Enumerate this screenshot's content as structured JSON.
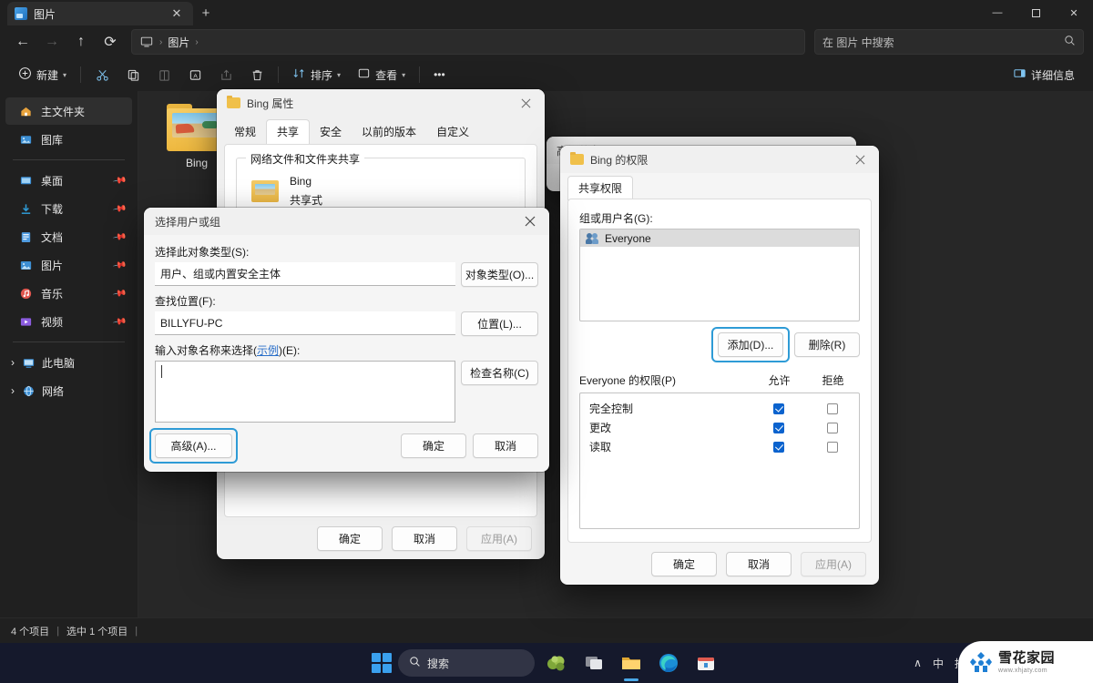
{
  "window": {
    "tab_title": "图片",
    "tab_close_glyph": "✕",
    "new_tab_glyph": "+",
    "minimize_glyph": "—",
    "maximize_glyph": "▢",
    "close_glyph": "✕"
  },
  "address": {
    "back_glyph": "←",
    "forward_glyph": "→",
    "up_glyph": "↑",
    "refresh_glyph": "⟳",
    "breadcrumb": [
      "图片"
    ],
    "separator": "›",
    "search_placeholder": "在 图片 中搜索",
    "search_icon": "⌕"
  },
  "toolbar": {
    "new_label": "新建",
    "cut_label": "剪切",
    "copy_label": "复制",
    "paste_label": "粘贴",
    "rename_label": "重命名",
    "share_label": "共享",
    "delete_label": "删除",
    "sort_label": "排序",
    "view_label": "查看",
    "more_label": "•••",
    "details_label": "详细信息"
  },
  "sidebar": {
    "items": [
      {
        "label": "主文件夹",
        "icon": "home-icon",
        "selected": true,
        "pinned": false
      },
      {
        "label": "图库",
        "icon": "gallery-icon",
        "selected": false,
        "pinned": false
      }
    ],
    "quick": [
      {
        "label": "桌面",
        "icon": "desktop-icon",
        "pinned": true
      },
      {
        "label": "下载",
        "icon": "downloads-icon",
        "pinned": true
      },
      {
        "label": "文档",
        "icon": "documents-icon",
        "pinned": true
      },
      {
        "label": "图片",
        "icon": "pictures-icon",
        "pinned": true
      },
      {
        "label": "音乐",
        "icon": "music-icon",
        "pinned": true
      },
      {
        "label": "视频",
        "icon": "videos-icon",
        "pinned": true
      }
    ],
    "groups": [
      {
        "label": "此电脑",
        "icon": "this-pc-icon"
      },
      {
        "label": "网络",
        "icon": "network-icon"
      }
    ]
  },
  "content": {
    "files": [
      {
        "name": "Bing",
        "type": "folder"
      }
    ]
  },
  "status": {
    "item_count": "4 个项目",
    "separator": "|",
    "selection": "选中 1 个项目"
  },
  "advanced_sharing_dialog": {
    "title": "高级共享"
  },
  "properties_dialog": {
    "title": "Bing 属性",
    "close_glyph": "✕",
    "tabs": [
      {
        "label": "常规",
        "active": false
      },
      {
        "label": "共享",
        "active": true
      },
      {
        "label": "安全",
        "active": false
      },
      {
        "label": "以前的版本",
        "active": false
      },
      {
        "label": "自定义",
        "active": false
      }
    ],
    "group_legend": "网络文件和文件夹共享",
    "share_name": "Bing",
    "share_state": "共享式",
    "buttons": {
      "ok": "确定",
      "cancel": "取消",
      "apply": "应用(A)"
    }
  },
  "select_users_dialog": {
    "title": "选择用户或组",
    "close_glyph": "✕",
    "object_type_label": "选择此对象类型(S):",
    "object_type_value": "用户、组或内置安全主体",
    "object_type_button": "对象类型(O)...",
    "location_label": "查找位置(F):",
    "location_value": "BILLYFU-PC",
    "location_button": "位置(L)...",
    "names_label_prefix": "输入对象名称来选择(",
    "names_label_link": "示例",
    "names_label_suffix": ")(E):",
    "names_value": "",
    "check_names_button": "检查名称(C)",
    "advanced_button": "高级(A)...",
    "advanced_focused": true,
    "ok_button": "确定",
    "cancel_button": "取消"
  },
  "permissions_dialog": {
    "title": "Bing 的权限",
    "close_glyph": "✕",
    "tab_label": "共享权限",
    "group_names_label": "组或用户名(G):",
    "group_list": [
      {
        "name": "Everyone",
        "selected": true
      }
    ],
    "add_button": "添加(D)...",
    "add_focused": true,
    "remove_button": "删除(R)",
    "perm_header": "Everyone 的权限(P)",
    "col_allow": "允许",
    "col_deny": "拒绝",
    "permissions": [
      {
        "name": "完全控制",
        "allow": true,
        "deny": false
      },
      {
        "name": "更改",
        "allow": true,
        "deny": false
      },
      {
        "name": "读取",
        "allow": true,
        "deny": false
      }
    ],
    "buttons": {
      "ok": "确定",
      "cancel": "取消",
      "apply": "应用(A)"
    }
  },
  "taskbar": {
    "start_label": "开始",
    "search_placeholder": "搜索",
    "search_icon": "⌕",
    "apps": [
      {
        "name": "game-app-icon"
      },
      {
        "name": "task-view-icon"
      },
      {
        "name": "file-explorer-icon",
        "active": true
      },
      {
        "name": "edge-browser-icon"
      },
      {
        "name": "microsoft-store-icon"
      }
    ],
    "tray": {
      "chevron": "∧",
      "ime_mode": "中",
      "ime_pinyin": "拼"
    }
  },
  "watermark": {
    "title": "雪花家园",
    "url": "www.xhjaty.com"
  },
  "colors": {
    "accent": "#2e9bd6",
    "checkbox_on": "#0b63ce",
    "window_bg": "#202020",
    "content_bg": "#272727",
    "dialog_bg": "#f0f0f0"
  }
}
